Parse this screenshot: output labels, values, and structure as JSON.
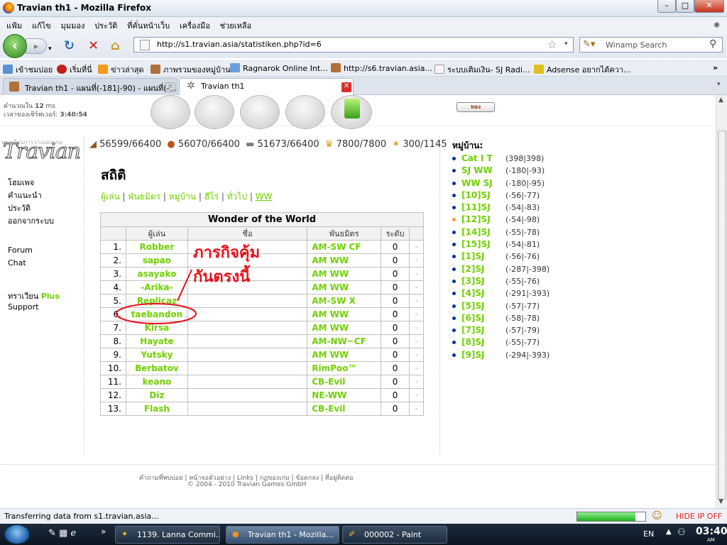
{
  "window": {
    "title": "Travian th1 - Mozilla Firefox",
    "min": "–",
    "max": "□",
    "close": "✕"
  },
  "menu": [
    "แฟ้ม",
    "แก้ไข",
    "มุมมอง",
    "ประวัติ",
    "ที่คั่นหน้าเว็บ",
    "เครื่องมือ",
    "ช่วยเหลือ"
  ],
  "nav": {
    "url": "http://s1.travian.asia/statistiken.php?id=6",
    "search_placeholder": "Winamp Search"
  },
  "bookmarks": [
    "เข้าชมบ่อย",
    "เริ่มที่นี่",
    "ข่าวล่าสุด",
    "ภาพรวมของหมู่บ้าน",
    "Ragnarok Online Int...",
    "http://s6.travian.asia...",
    "ระบบเติมเงิน- SJ Radi...",
    "Adsense อยากได้ควา..."
  ],
  "tabs": [
    {
      "label": "Travian th1 - แผนที่(-181|-90) - แผนที่(-..."
    },
    {
      "label": "Travian th1"
    }
  ],
  "game": {
    "calc_prefix": "คำนวณใน",
    "calc_value": "12",
    "calc_unit": "ms",
    "server_time_label": "เวลาของเซิร์ฟเวอร์:",
    "server_time": "3:40:54",
    "gold_button": "ทอง",
    "logo_caption": "ทราเวียนการวางแผนเกม",
    "logo_text": "Travian",
    "resources": {
      "wood": "56599/66400",
      "clay": "56070/66400",
      "iron": "51673/66400",
      "crop": "7800/7800",
      "crop_consumption": "300/1145"
    },
    "sidebar": [
      "โฮมเพจ",
      "คำแนะนำ",
      "ประวัติ",
      "ออกจากระบบ"
    ],
    "sidebar2": [
      "Forum",
      "Chat"
    ],
    "plus_prefix": "ทราเวียน",
    "plus_label": "Plus",
    "support": "Support",
    "page_title": "สถิติ",
    "stat_tabs": [
      "ผู้เล่น",
      "พันธมิตร",
      "หมู่บ้าน",
      "ฮีโร่",
      "ทั่วไป",
      "WW"
    ],
    "table_title": "Wonder of the World",
    "col_player": "ผู้เล่น",
    "col_name": "ชื่อ",
    "col_alliance": "พันธมิตร",
    "col_level": "ระดับ",
    "rows": [
      {
        "rank": "1.",
        "player": "Robber",
        "name": "",
        "alliance": "AM-SW CF",
        "level": "0",
        "tail": "-"
      },
      {
        "rank": "2.",
        "player": "sapao",
        "name": "",
        "alliance": "AM WW",
        "level": "0",
        "tail": "-"
      },
      {
        "rank": "3.",
        "player": "asayako",
        "name": "",
        "alliance": "AM WW",
        "level": "0",
        "tail": "-"
      },
      {
        "rank": "4.",
        "player": "-Arika-",
        "name": "",
        "alliance": "AM WW",
        "level": "0",
        "tail": "-"
      },
      {
        "rank": "5.",
        "player": "Replicaz",
        "name": "",
        "alliance": "AM-SW X",
        "level": "0",
        "tail": "-"
      },
      {
        "rank": "6.",
        "player": "taebandon",
        "name": "",
        "alliance": "AM WW",
        "level": "0",
        "tail": "-"
      },
      {
        "rank": "7.",
        "player": "Kirsa",
        "name": "",
        "alliance": "AM WW",
        "level": "0",
        "tail": "-"
      },
      {
        "rank": "8.",
        "player": "Hayate",
        "name": "",
        "alliance": "AM-NW~CF",
        "level": "0",
        "tail": "-"
      },
      {
        "rank": "9.",
        "player": "Yutsky",
        "name": "",
        "alliance": "AM WW",
        "level": "0",
        "tail": "-"
      },
      {
        "rank": "10.",
        "player": "Berbatov",
        "name": "",
        "alliance": "RimPoo™",
        "level": "0",
        "tail": "-"
      },
      {
        "rank": "11.",
        "player": "keano",
        "name": "",
        "alliance": "CB-Evil",
        "level": "0",
        "tail": "-"
      },
      {
        "rank": "12.",
        "player": "Diz",
        "name": "",
        "alliance": "NE-WW",
        "level": "0",
        "tail": "-"
      },
      {
        "rank": "13.",
        "player": "Flash",
        "name": "",
        "alliance": "CB-Evil",
        "level": "0",
        "tail": "-"
      }
    ],
    "annotation": {
      "line1": "ภารกิจคุ้ม",
      "line2": "กันตรงนี้",
      "color": "#e8101a"
    },
    "villages_title": "หมู่บ้าน:",
    "villages": [
      {
        "name": "Cat I T",
        "coords": "(398|398)"
      },
      {
        "name": "SJ WW",
        "coords": "(-180|-93)"
      },
      {
        "name": "WW SJ",
        "coords": "(-180|-95)"
      },
      {
        "name": "[10]SJ",
        "coords": "(-56|-77)"
      },
      {
        "name": "[11]SJ",
        "coords": "(-54|-83)"
      },
      {
        "name": "[12]SJ",
        "coords": "(-54|-98)",
        "active": true
      },
      {
        "name": "[14]SJ",
        "coords": "(-55|-78)"
      },
      {
        "name": "[15]SJ",
        "coords": "(-54|-81)"
      },
      {
        "name": "[1]SJ",
        "coords": "(-56|-76)"
      },
      {
        "name": "[2]SJ",
        "coords": "(-287|-398)"
      },
      {
        "name": "[3]SJ",
        "coords": "(-55|-76)"
      },
      {
        "name": "[4]SJ",
        "coords": "(-291|-393)"
      },
      {
        "name": "[5]SJ",
        "coords": "(-57|-77)"
      },
      {
        "name": "[6]SJ",
        "coords": "(-58|-78)"
      },
      {
        "name": "[7]SJ",
        "coords": "(-57|-79)"
      },
      {
        "name": "[8]SJ",
        "coords": "(-55|-77)"
      },
      {
        "name": "[9]SJ",
        "coords": "(-294|-393)"
      }
    ],
    "footer_links": [
      "คำถามที่พบบ่อย",
      "หน้าจอตัวอย่าง",
      "Links",
      "กฎของเกม",
      "ข้อตกลง",
      "ที่อยู่ติดต่อ"
    ],
    "copyright": "© 2004 - 2010 Travian Games GmbH"
  },
  "status": {
    "text": "Transferring data from s1.travian.asia...",
    "hide_ip": "HIDE IP OFF",
    "progress": 0.85
  },
  "taskbar": {
    "tasks": [
      "1139. Lanna Commi...",
      "Travian th1 - Mozilla...",
      "000002 - Paint"
    ],
    "lang": "EN",
    "time": "03:40",
    "ampm": "AM"
  },
  "colors": {
    "link_green": "#71d000",
    "annotation_red": "#e8101a"
  }
}
